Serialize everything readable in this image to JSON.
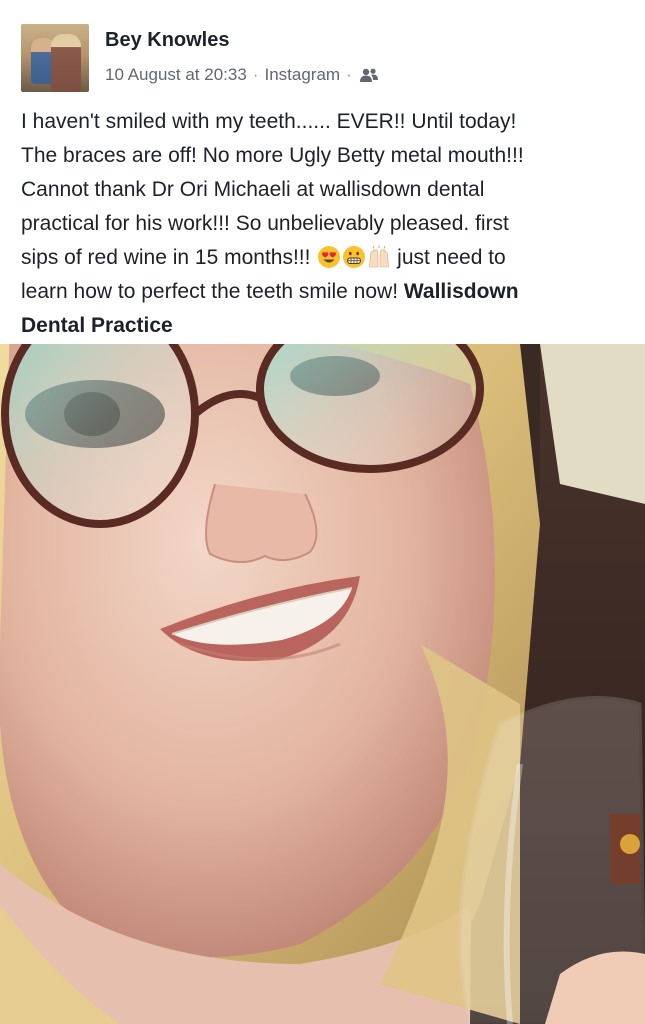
{
  "post": {
    "author_name": "Bey Knowles",
    "timestamp": "10 August at 20:33",
    "source": "Instagram",
    "separator": "·",
    "audience_icon": "friends-icon",
    "text_lines": [
      "I haven't smiled with my teeth...... EVER!! Until today!",
      "The braces are off! No more Ugly Betty metal mouth!!!",
      "Cannot thank Dr Ori Michaeli at  wallisdown dental",
      "practical for his work!!! So unbelievably pleased. first",
      "sips of red wine in 15 months!!! ",
      " just need to",
      "learn how to perfect the teeth smile now! "
    ],
    "tagged_page_line1": "Wallisdown",
    "tagged_page_line2": "Dental Practice",
    "emojis": [
      "heart-eyes-emoji",
      "grimacing-emoji",
      "raised-hands-emoji"
    ]
  },
  "colors": {
    "name_text": "#1d2129",
    "meta_text": "#616770",
    "background": "#ffffff"
  }
}
